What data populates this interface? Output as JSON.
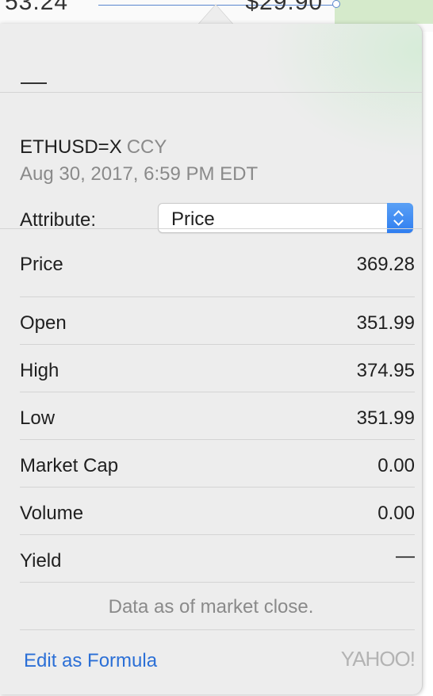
{
  "background": {
    "cell_left_text": "53.24",
    "cell_right_text": " $29.90"
  },
  "header": {
    "dash": "—"
  },
  "quote": {
    "symbol": "ETHUSD=X",
    "type": "CCY",
    "timestamp": "Aug 30, 2017, 6:59 PM EDT"
  },
  "attribute": {
    "label": "Attribute:",
    "selected": "Price"
  },
  "fields": [
    {
      "label": "Price",
      "value": "369.28"
    },
    {
      "label": "Open",
      "value": "351.99"
    },
    {
      "label": "High",
      "value": "374.95"
    },
    {
      "label": "Low",
      "value": "351.99"
    },
    {
      "label": "Market Cap",
      "value": "0.00"
    },
    {
      "label": "Volume",
      "value": "0.00"
    },
    {
      "label": "Yield",
      "value": "—"
    }
  ],
  "footer": {
    "note": "Data as of market close.",
    "edit_link": "Edit as Formula",
    "provider_logo": "YAHOO!"
  },
  "colors": {
    "link": "#2b6fd6",
    "accent_stepper": "#2f7ef0",
    "popover_bg": "#ededed"
  }
}
